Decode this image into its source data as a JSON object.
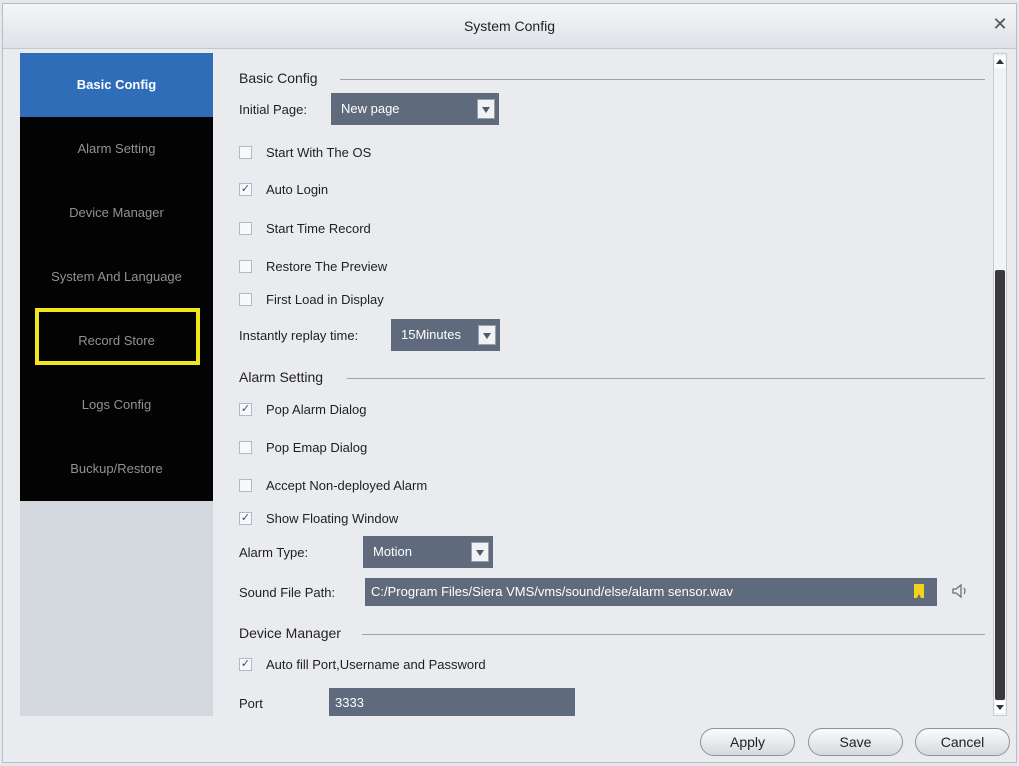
{
  "window": {
    "title": "System Config"
  },
  "sidebar": {
    "items": [
      {
        "label": "Basic Config",
        "active": true
      },
      {
        "label": "Alarm Setting",
        "active": false
      },
      {
        "label": "Device Manager",
        "active": false
      },
      {
        "label": "System And Language",
        "active": false
      },
      {
        "label": "Record Store",
        "active": false
      },
      {
        "label": "Logs Config",
        "active": false
      },
      {
        "label": "Buckup/Restore",
        "active": false
      }
    ]
  },
  "basic_config": {
    "heading": "Basic Config",
    "initial_page_label": "Initial Page:",
    "initial_page_value": "New page",
    "options": [
      {
        "label": "Start With The OS",
        "checked": false
      },
      {
        "label": "Auto Login",
        "checked": true
      },
      {
        "label": "Start Time Record",
        "checked": false
      },
      {
        "label": "Restore The Preview",
        "checked": false
      },
      {
        "label": "First Load in Display",
        "checked": false
      }
    ],
    "replay_label": "Instantly replay time:",
    "replay_value": "15Minutes"
  },
  "alarm_setting": {
    "heading": "Alarm Setting",
    "options": [
      {
        "label": "Pop Alarm Dialog",
        "checked": true
      },
      {
        "label": "Pop Emap Dialog",
        "checked": false
      },
      {
        "label": "Accept Non-deployed Alarm",
        "checked": false
      },
      {
        "label": "Show Floating Window",
        "checked": true
      }
    ],
    "alarm_type_label": "Alarm Type:",
    "alarm_type_value": "Motion",
    "sound_path_label": "Sound File Path:",
    "sound_path_value": "C:/Program Files/Siera VMS/vms/sound/else/alarm sensor.wav"
  },
  "device_manager": {
    "heading": "Device Manager",
    "autofill_label": "Auto fill Port,Username and Password",
    "autofill_checked": true,
    "port_label": "Port",
    "port_value": "3333"
  },
  "buttons": {
    "apply": "Apply",
    "save": "Save",
    "cancel": "Cancel"
  },
  "icons": {
    "close": "close-icon",
    "folder": "folder-icon",
    "speaker": "speaker-icon",
    "check": "✓"
  },
  "colors": {
    "active_nav": "#2f6db9",
    "nav_background": "#030303",
    "highlight": "#f2e51c",
    "field_background": "#5f6b7d"
  }
}
